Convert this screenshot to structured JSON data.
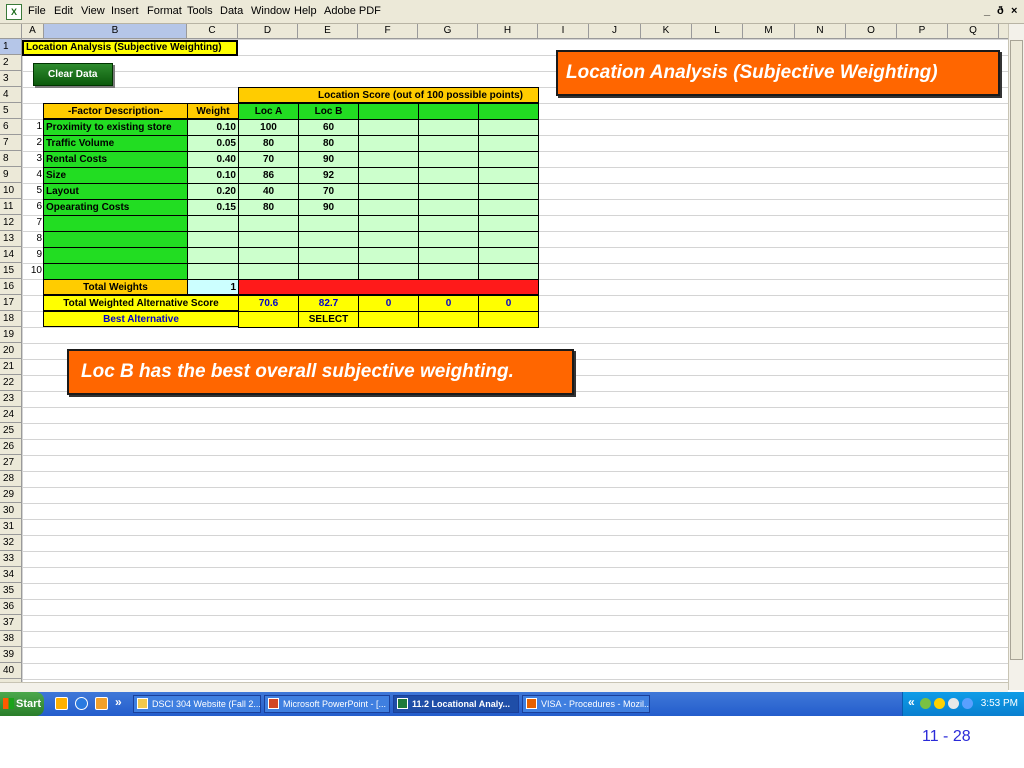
{
  "menu": {
    "items": [
      "File",
      "Edit",
      "View",
      "Insert",
      "Format",
      "Tools",
      "Data",
      "Window",
      "Help",
      "Adobe PDF"
    ],
    "window_controls": [
      "_",
      "ð",
      "×"
    ]
  },
  "sheet": {
    "columns": [
      "A",
      "B",
      "C",
      "D",
      "E",
      "F",
      "G",
      "H",
      "I",
      "J",
      "K",
      "L",
      "M",
      "N",
      "O",
      "P",
      "Q"
    ],
    "rows": [
      "1",
      "2",
      "3",
      "4",
      "5",
      "6",
      "7",
      "8",
      "9",
      "10",
      "11",
      "12",
      "13",
      "14",
      "15",
      "16",
      "17",
      "18",
      "19",
      "20",
      "21",
      "22",
      "23",
      "24",
      "25",
      "26",
      "27",
      "28",
      "29",
      "30",
      "31",
      "32",
      "33",
      "34",
      "35",
      "36",
      "37",
      "38",
      "39",
      "40",
      "41"
    ],
    "title": "Location Analysis (Subjective Weighting)",
    "clear_button": "Clear Data",
    "score_header": "Location Score (out of 100 possible points)",
    "factor_header": "-Factor Description-",
    "weight_header": "Weight",
    "loc_headers": [
      "Loc A",
      "Loc B",
      "",
      "",
      ""
    ],
    "factors": [
      {
        "n": "1",
        "name": "Proximity to existing store",
        "weight": "0.10",
        "a": "100",
        "b": "60"
      },
      {
        "n": "2",
        "name": "Traffic Volume",
        "weight": "0.05",
        "a": "80",
        "b": "80"
      },
      {
        "n": "3",
        "name": "Rental Costs",
        "weight": "0.40",
        "a": "70",
        "b": "90"
      },
      {
        "n": "4",
        "name": "Size",
        "weight": "0.10",
        "a": "86",
        "b": "92"
      },
      {
        "n": "5",
        "name": "Layout",
        "weight": "0.20",
        "a": "40",
        "b": "70"
      },
      {
        "n": "6",
        "name": "Opearating Costs",
        "weight": "0.15",
        "a": "80",
        "b": "90"
      },
      {
        "n": "7",
        "name": "",
        "weight": "",
        "a": "",
        "b": ""
      },
      {
        "n": "8",
        "name": "",
        "weight": "",
        "a": "",
        "b": ""
      },
      {
        "n": "9",
        "name": "",
        "weight": "",
        "a": "",
        "b": ""
      },
      {
        "n": "10",
        "name": "",
        "weight": "",
        "a": "",
        "b": ""
      }
    ],
    "total_weights_label": "Total Weights",
    "total_weights_value": "1",
    "weighted_score_label": "Total Weighted Alternative Score",
    "weighted_scores": [
      "70.6",
      "82.7",
      "0",
      "0",
      "0"
    ],
    "best_alt_label": "Best Alternative",
    "best_alt_values": [
      "",
      "SELECT",
      "",
      "",
      ""
    ]
  },
  "callouts": {
    "title": "Location Analysis (Subjective Weighting)",
    "note": "Loc B has the best overall subjective weighting."
  },
  "taskbar": {
    "start": "Start",
    "chevron": "»",
    "tasks": [
      {
        "label": "DSCI 304 Website (Fall 2...",
        "active": false,
        "icon": "folder-icon"
      },
      {
        "label": "Microsoft PowerPoint - [...",
        "active": false,
        "icon": "powerpoint-icon"
      },
      {
        "label": "11.2 Locational Analy...",
        "active": true,
        "icon": "excel-icon"
      },
      {
        "label": "VISA - Procedures - Mozil...",
        "active": false,
        "icon": "firefox-icon"
      }
    ],
    "tray_chevron": "«",
    "clock": "3:53 PM"
  },
  "slide_number": "11 - 28",
  "colors": {
    "callout_orange": "#ff6600",
    "factor_green": "#22dd22",
    "input_lightgreen": "#ccffcc",
    "total_yellow": "#ffff00",
    "header_gold": "#ffcc00",
    "check_red": "#ff1a1a"
  }
}
